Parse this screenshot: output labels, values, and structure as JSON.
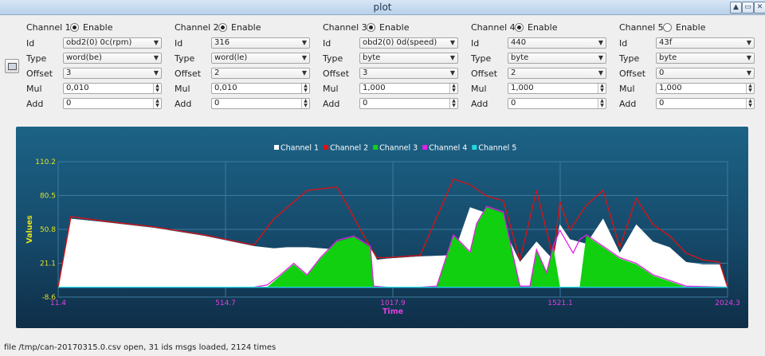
{
  "window": {
    "title": "plot",
    "buttons": [
      "▲",
      "▭",
      "✕"
    ]
  },
  "channels": [
    {
      "label": "Channel 1",
      "enabled": true,
      "enable_label": "Enable",
      "id": "obd2(0) 0c(rpm)",
      "type": "word(be)",
      "offset": "3",
      "mul": "0,010",
      "add": "0"
    },
    {
      "label": "Channel 2",
      "enabled": true,
      "enable_label": "Enable",
      "id": "316",
      "type": "word(le)",
      "offset": "2",
      "mul": "0,010",
      "add": "0"
    },
    {
      "label": "Channel 3",
      "enabled": true,
      "enable_label": "Enable",
      "id": "obd2(0) 0d(speed)",
      "type": "byte",
      "offset": "3",
      "mul": "1,000",
      "add": "0"
    },
    {
      "label": "Channel 4",
      "enabled": true,
      "enable_label": "Enable",
      "id": "440",
      "type": "byte",
      "offset": "2",
      "mul": "1,000",
      "add": "0"
    },
    {
      "label": "Channel 5",
      "enabled": false,
      "enable_label": "Enable",
      "id": "43f",
      "type": "byte",
      "offset": "0",
      "mul": "1,000",
      "add": "0"
    }
  ],
  "field_labels": {
    "id": "Id",
    "type": "Type",
    "offset": "Offset",
    "mul": "Mul",
    "add": "Add"
  },
  "chart_data": {
    "type": "area",
    "xlabel": "Time",
    "ylabel": "Values",
    "xlim": [
      11.4,
      2024.3
    ],
    "ylim": [
      -8.6,
      110.2
    ],
    "xticks": [
      "11.4",
      "514.7",
      "1017.9",
      "1521.1",
      "2024.3"
    ],
    "yticks": [
      "110.2",
      "80.5",
      "50.8",
      "21.1",
      "-8.6"
    ],
    "grid": true,
    "legend_position": "top-center",
    "colors": {
      "Channel 1": "#ffffff",
      "Channel 2": "#e01010",
      "Channel 3": "#10d010",
      "Channel 4": "#e020e0",
      "Channel 5": "#20d8e0"
    },
    "series": [
      {
        "name": "Channel 1",
        "x": [
          11.4,
          50,
          150,
          300,
          450,
          600,
          660,
          700,
          760,
          850,
          950,
          970,
          1000,
          1100,
          1200,
          1250,
          1300,
          1350,
          1400,
          1450,
          1500,
          1520,
          1550,
          1600,
          1650,
          1700,
          1750,
          1800,
          1850,
          1900,
          1950,
          2000,
          2024.3
        ],
        "y": [
          0,
          60,
          57,
          52,
          45,
          36,
          34,
          35,
          35,
          33,
          35,
          24,
          25,
          27,
          28,
          70,
          65,
          52,
          22,
          40,
          24,
          55,
          42,
          38,
          60,
          30,
          55,
          40,
          35,
          22,
          20,
          20,
          0
        ]
      },
      {
        "name": "Channel 2",
        "x": [
          11.4,
          50,
          150,
          300,
          450,
          600,
          660,
          700,
          760,
          850,
          950,
          970,
          1000,
          1100,
          1200,
          1250,
          1300,
          1350,
          1400,
          1450,
          1500,
          1520,
          1550,
          1600,
          1650,
          1700,
          1750,
          1800,
          1850,
          1900,
          1950,
          2000,
          2024.3
        ],
        "y": [
          0,
          62,
          58,
          53,
          46,
          37,
          60,
          70,
          85,
          88,
          35,
          26,
          26,
          28,
          95,
          90,
          80,
          76,
          24,
          85,
          26,
          75,
          50,
          72,
          85,
          35,
          78,
          55,
          45,
          30,
          24,
          22,
          0
        ]
      },
      {
        "name": "Channel 3",
        "x": [
          11.4,
          600,
          640,
          680,
          720,
          760,
          800,
          850,
          900,
          950,
          960,
          1000,
          1100,
          1150,
          1200,
          1250,
          1270,
          1300,
          1350,
          1400,
          1430,
          1450,
          1480,
          1500,
          1520,
          1560,
          1580,
          1600,
          1650,
          1700,
          1750,
          1800,
          1850,
          1900,
          2024.3
        ],
        "y": [
          0,
          0,
          0,
          10,
          20,
          10,
          25,
          40,
          44,
          35,
          0,
          0,
          0,
          0,
          45,
          30,
          55,
          70,
          65,
          0,
          0,
          32,
          12,
          35,
          0,
          0,
          0,
          45,
          35,
          25,
          20,
          10,
          5,
          0,
          0
        ]
      },
      {
        "name": "Channel 4",
        "x": [
          11.4,
          600,
          640,
          680,
          720,
          760,
          800,
          850,
          900,
          950,
          960,
          1000,
          1100,
          1150,
          1200,
          1250,
          1270,
          1300,
          1350,
          1400,
          1430,
          1450,
          1480,
          1500,
          1520,
          1560,
          1580,
          1600,
          1650,
          1700,
          1750,
          1800,
          1850,
          1900,
          2024.3
        ],
        "y": [
          0,
          0,
          2,
          11,
          21,
          11,
          26,
          41,
          45,
          36,
          1,
          0,
          0,
          1,
          46,
          31,
          56,
          71,
          66,
          1,
          1,
          33,
          13,
          36,
          50,
          30,
          42,
          46,
          36,
          26,
          21,
          11,
          6,
          1,
          0
        ]
      },
      {
        "name": "Channel 5",
        "x": [
          11.4,
          2024.3
        ],
        "y": [
          0,
          0
        ]
      }
    ]
  },
  "status": "file /tmp/can-20170315.0.csv open, 31 ids msgs loaded, 2124 times"
}
